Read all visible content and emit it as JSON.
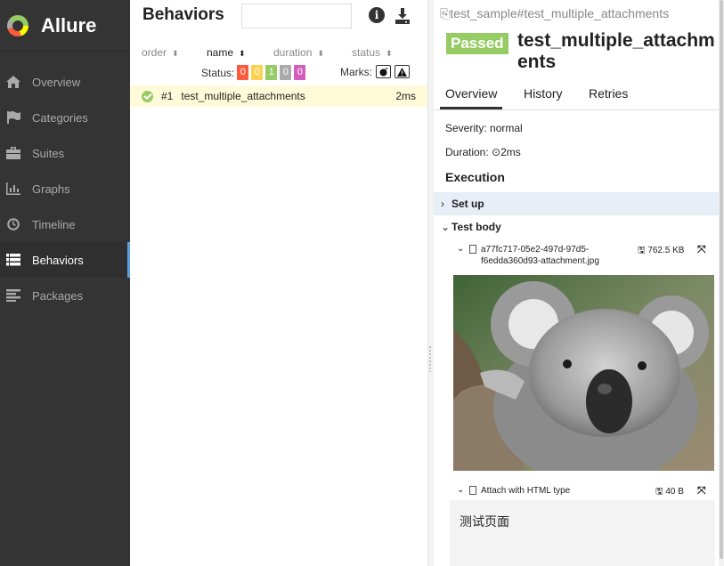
{
  "sidebar": {
    "brand": "Allure",
    "items": [
      {
        "label": "Overview",
        "icon": "home-icon"
      },
      {
        "label": "Categories",
        "icon": "flag-icon"
      },
      {
        "label": "Suites",
        "icon": "briefcase-icon"
      },
      {
        "label": "Graphs",
        "icon": "bar-chart-icon"
      },
      {
        "label": "Timeline",
        "icon": "clock-icon"
      },
      {
        "label": "Behaviors",
        "icon": "list-icon",
        "active": true
      },
      {
        "label": "Packages",
        "icon": "align-left-icon"
      }
    ]
  },
  "behaviors": {
    "title": "Behaviors",
    "search_value": "",
    "sorters": [
      {
        "label": "order"
      },
      {
        "label": "name"
      },
      {
        "label": "duration"
      },
      {
        "label": "status"
      }
    ],
    "status_label": "Status:",
    "status_counts": [
      {
        "value": "0",
        "color": "#fd5a3e"
      },
      {
        "value": "0",
        "color": "#ffd050"
      },
      {
        "value": "1",
        "color": "#97cc64"
      },
      {
        "value": "0",
        "color": "#aaaaaa"
      },
      {
        "value": "0",
        "color": "#d35ebe"
      }
    ],
    "marks_label": "Marks:",
    "rows": [
      {
        "number": "#1",
        "name": "test_multiple_attachments",
        "duration": "2ms",
        "status": "passed"
      }
    ]
  },
  "testcase": {
    "breadcrumb": "test_sample#test_multiple_attachments",
    "status_badge": "Passed",
    "title": "test_multiple_attachments",
    "tabs": [
      "Overview",
      "History",
      "Retries"
    ],
    "severity": "Severity: normal",
    "duration_label": "Duration:",
    "duration_value": "2ms",
    "execution_title": "Execution",
    "setup_label": "Set up",
    "body_label": "Test body",
    "attachments": [
      {
        "name": "a77fc717-05e2-497d-97d5-f6edda360d93-attachment.jpg",
        "size": "762.5 KB"
      },
      {
        "name": "Attach with HTML type",
        "size": "40 B",
        "content": "测试页面"
      }
    ]
  },
  "colors": {
    "passed": "#97cc64",
    "sidebar_bg": "#343434",
    "row_highlight": "#fffbd9",
    "accent": "#5aa0de"
  }
}
